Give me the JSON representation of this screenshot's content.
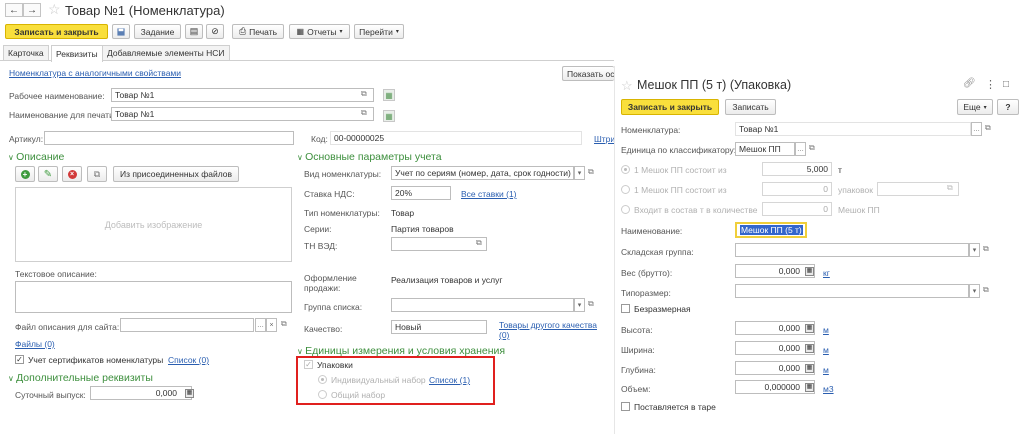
{
  "left": {
    "title": "Товар №1 (Номенклатура)",
    "toolbar": {
      "save_close": "Записать и закрыть",
      "task": "Задание",
      "print": "Печать",
      "reports": "Отчеты",
      "goto": "Перейти"
    },
    "tabs": [
      "Карточка",
      "Реквизиты",
      "Добавляемые элементы НСИ"
    ],
    "similar_link": "Номенклатура с аналогичными свойствами",
    "show_button": "Показать ос",
    "work_name_label": "Рабочее наименование:",
    "work_name_value": "Товар №1",
    "print_name_label": "Наименование для печати:",
    "print_name_value": "Товар №1",
    "article_label": "Артикул:",
    "code_label": "Код:",
    "code_value": "00-00000025",
    "barcode_link": "Штри",
    "description": {
      "header": "Описание",
      "attached_files_button": "Из присоединенных файлов",
      "add_image": "Добавить изображение",
      "text_desc_label": "Текстовое описание:",
      "site_file_label": "Файл описания для сайта:",
      "files_link": "Файлы (0)",
      "cert_label": "Учет сертификатов номенклатуры",
      "cert_link": "Список (0)"
    },
    "extra": {
      "header": "Дополнительные реквизиты",
      "daily_label": "Суточный выпуск:",
      "daily_value": "0,000"
    },
    "accounting": {
      "header": "Основные параметры учета",
      "kind_label": "Вид номенклатуры:",
      "kind_value": "Учет по сериям (номер, дата, срок годности)",
      "vat_label": "Ставка НДС:",
      "vat_value": "20%",
      "vat_link": "Все ставки (1)",
      "type_label": "Тип номенклатуры:",
      "type_value": "Товар",
      "series_label": "Серии:",
      "series_value": "Партия товаров",
      "tnved_label": "ТН ВЭД:",
      "sale_label_1": "Оформление",
      "sale_label_2": "продажи:",
      "sale_value": "Реализация товаров и услуг",
      "group_label": "Группа списка:",
      "quality_label": "Качество:",
      "quality_value": "Новый",
      "quality_link_1": "Товары другого качества",
      "quality_link_2": "(0)"
    },
    "units": {
      "header": "Единицы измерения и условия хранения",
      "packages_label": "Упаковки",
      "individual_label": "Индивидуальный набор",
      "individual_link": "Список (1)",
      "common_label": "Общий набор"
    }
  },
  "right": {
    "title": "Мешок ПП (5 т) (Упаковка)",
    "save_close": "Записать и закрыть",
    "save": "Записать",
    "more": "Еще",
    "help": "?",
    "nomenclature_label": "Номенклатура:",
    "nomenclature_value": "Товар №1",
    "classifier_label": "Единица по классификатору:",
    "classifier_value": "Мешок ПП",
    "r1_label": "1 Мешок ПП состоит из",
    "r1_value": "5,000",
    "r1_unit": "т",
    "r2_label": "1 Мешок ПП состоит из",
    "r2_value": "0",
    "r2_unit": "упаковок",
    "r3_label": "Входит в состав т в количестве",
    "r3_value": "0",
    "r3_unit": "Мешок ПП",
    "name_label": "Наименование:",
    "name_value": "Мешок ПП (5 т)",
    "warehouse_label": "Складская группа:",
    "weight_label": "Вес (брутто):",
    "weight_value": "0,000",
    "weight_unit": "кг",
    "size_label": "Типоразмер:",
    "sizeless_label": "Безразмерная",
    "height_label": "Высота:",
    "height_value": "0,000",
    "height_unit": "м",
    "width_label": "Ширина:",
    "width_value": "0,000",
    "width_unit": "м",
    "depth_label": "Глубина:",
    "depth_value": "0,000",
    "depth_unit": "м",
    "volume_label": "Объем:",
    "volume_value": "0,000000",
    "volume_unit": "м3",
    "tare_label": "Поставляется в таре"
  },
  "colors": {
    "accent_yellow": "#f9df3c",
    "section_green": "#3d8f3d",
    "link_blue": "#2a5eb0",
    "highlight_red": "#e0201e"
  },
  "icons": [
    "back-arrow-icon",
    "forward-arrow-icon",
    "star-icon",
    "save-icon",
    "document-icon",
    "attach-icon",
    "printer-icon",
    "reports-icon",
    "add-icon",
    "edit-icon",
    "delete-icon",
    "copy-icon",
    "link-icon",
    "more-icon",
    "window-icon"
  ]
}
